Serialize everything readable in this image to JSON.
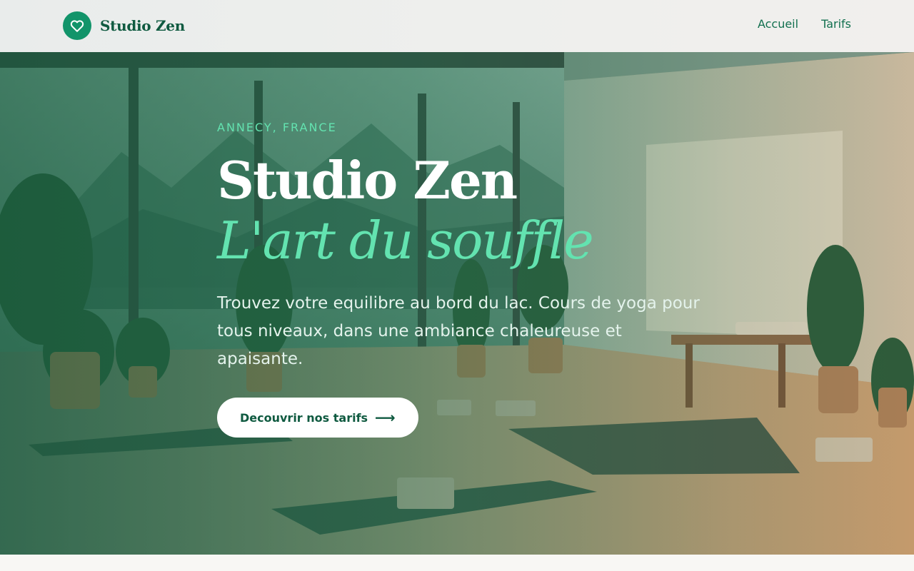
{
  "header": {
    "brand_name": "Studio Zen",
    "brand_icon": "heart-icon",
    "nav": [
      {
        "label": "Accueil"
      },
      {
        "label": "Tarifs"
      }
    ]
  },
  "hero": {
    "eyebrow": "ANNECY, FRANCE",
    "title": "Studio Zen",
    "subtitle": "L'art du souffle",
    "description": "Trouvez votre equilibre au bord du lac. Cours de yoga pour tous niveaux, dans une ambiance chaleureuse et apaisante.",
    "cta_label": "Decouvrir nos tarifs",
    "cta_icon": "arrow-right-icon"
  },
  "colors": {
    "accent": "#63e3b0",
    "brand_green": "#12946a",
    "brand_dark": "#0f5a40"
  }
}
